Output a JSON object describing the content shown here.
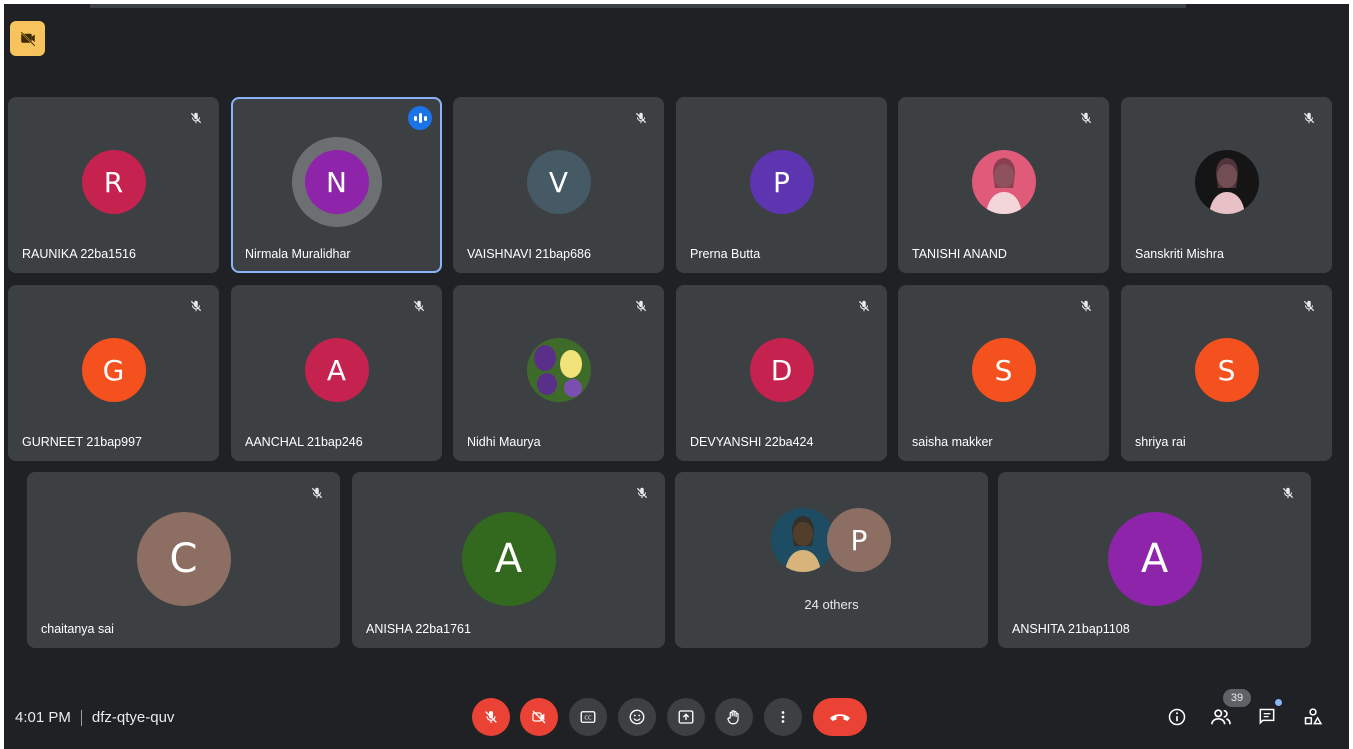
{
  "colors": {
    "background": "#202124",
    "tile": "#3c4043",
    "active_outline": "#8ab4f8",
    "alert_red": "#ea4335",
    "badge_yellow": "#f6c35c"
  },
  "corner_badge": {
    "icon": "hide-self-view-icon"
  },
  "participants": [
    {
      "name": "RAUNIKA 22ba1516",
      "initial": "R",
      "color": "#c5224f",
      "mic": "muted"
    },
    {
      "name": "Nirmala Muralidhar",
      "initial": "N",
      "color": "#8e24aa",
      "mic": "speaking",
      "active": true
    },
    {
      "name": "VAISHNAVI 21bap686",
      "initial": "V",
      "color": "#455a64",
      "mic": "muted"
    },
    {
      "name": "Prerna Butta",
      "initial": "P",
      "color": "#5e35b1",
      "mic": "none"
    },
    {
      "name": "TANISHI ANAND",
      "photo": "profile-photo-pink",
      "mic": "muted"
    },
    {
      "name": "Sanskriti Mishra",
      "photo": "profile-photo-dark",
      "mic": "muted"
    },
    {
      "name": "GURNEET 21bap997",
      "initial": "G",
      "color": "#f4511e",
      "mic": "muted"
    },
    {
      "name": "AANCHAL 21bap246",
      "initial": "A",
      "color": "#c5224f",
      "mic": "muted"
    },
    {
      "name": "Nidhi Maurya",
      "photo": "profile-photo-flowers",
      "mic": "muted"
    },
    {
      "name": "DEVYANSHI 22ba424",
      "initial": "D",
      "color": "#c5224f",
      "mic": "muted"
    },
    {
      "name": "saisha makker",
      "initial": "S",
      "color": "#f4511e",
      "mic": "muted"
    },
    {
      "name": "shriya rai",
      "initial": "S",
      "color": "#f4511e",
      "mic": "muted"
    },
    {
      "name": "chaitanya sai",
      "initial": "C",
      "color": "#8d6e63",
      "mic": "muted"
    },
    {
      "name": "ANISHA 22ba1761",
      "initial": "A",
      "color": "#33691e",
      "mic": "muted"
    },
    {
      "name": "ANSHITA 21bap1108",
      "initial": "A",
      "color": "#8e24aa",
      "mic": "muted"
    }
  ],
  "others_tile": {
    "label": "24 others",
    "avatar_initial": "P",
    "avatar_color": "#8d6e63",
    "photo": "profile-photo-dark-blue"
  },
  "bottom_bar": {
    "time": "4:01 PM",
    "meeting_code": "dfz-qtye-quv",
    "controls": [
      {
        "name": "mic-off-button",
        "icon": "mic-off-icon",
        "state": "off"
      },
      {
        "name": "camera-off-button",
        "icon": "videocam-off-icon",
        "state": "off"
      },
      {
        "name": "captions-button",
        "icon": "closed-captions-icon"
      },
      {
        "name": "reactions-button",
        "icon": "emoji-icon"
      },
      {
        "name": "present-button",
        "icon": "present-screen-icon"
      },
      {
        "name": "raise-hand-button",
        "icon": "hand-icon"
      },
      {
        "name": "more-options-button",
        "icon": "more-vert-icon"
      },
      {
        "name": "leave-call-button",
        "icon": "call-end-icon"
      }
    ],
    "right_icons": [
      "info-icon",
      "people-icon",
      "chat-icon",
      "activities-icon"
    ],
    "people_count": "39"
  }
}
